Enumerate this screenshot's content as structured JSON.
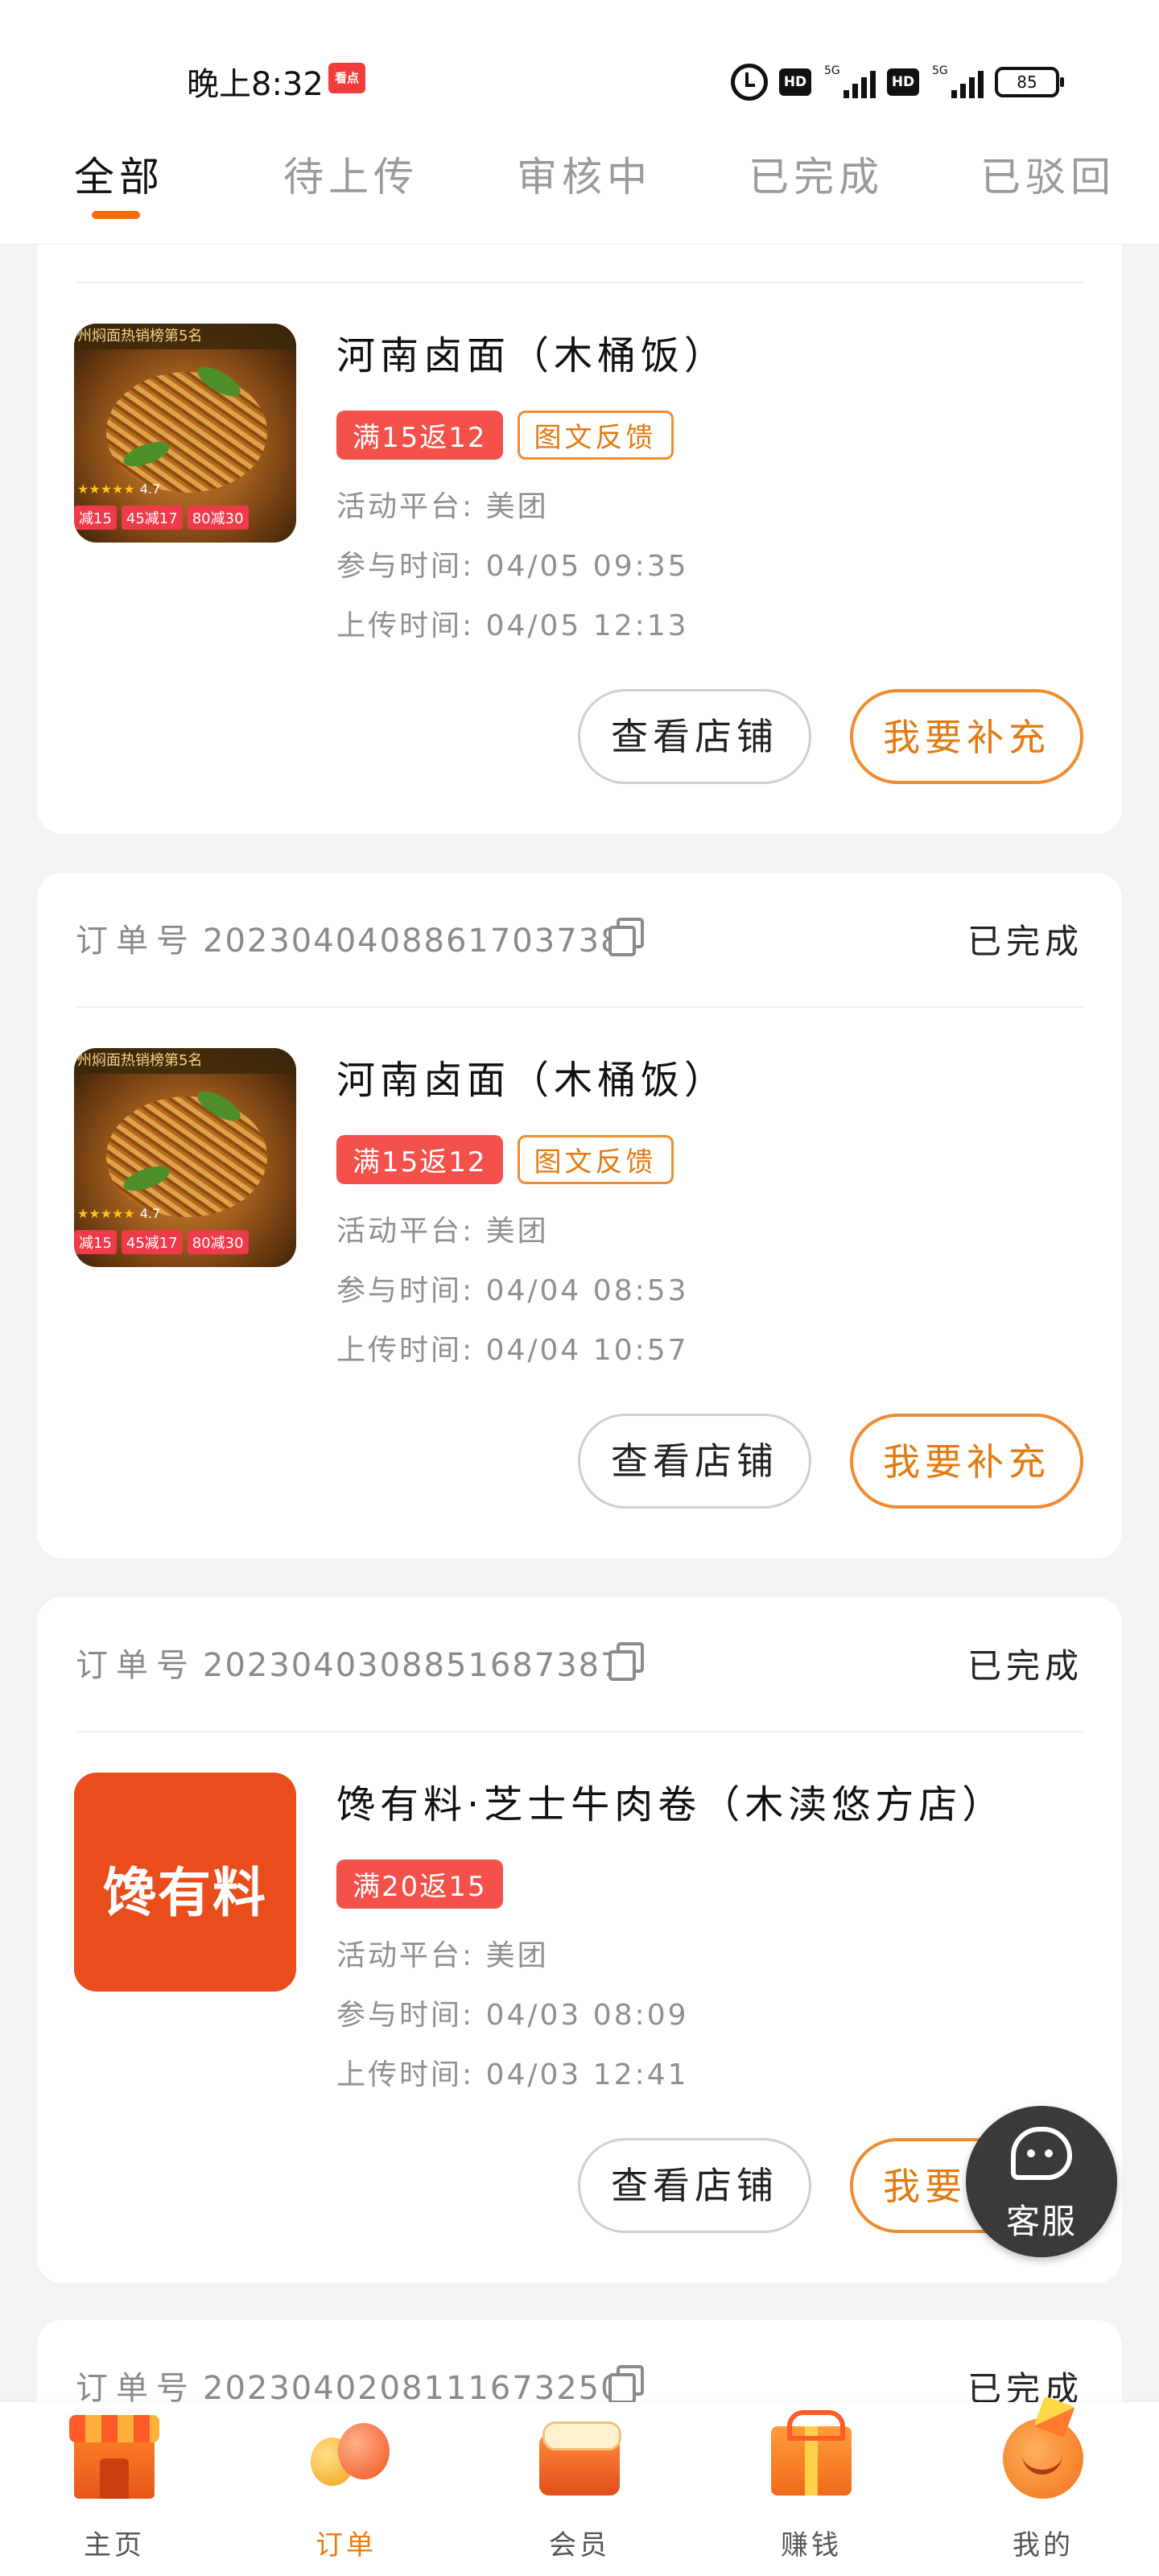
{
  "status_bar": {
    "time": "晚上8:32",
    "app_badge": "看点",
    "hd1": "HD",
    "hd2": "HD",
    "net1": "5G",
    "net2": "5G",
    "battery": "85"
  },
  "tabs": [
    {
      "label": "全部"
    },
    {
      "label": "待上传"
    },
    {
      "label": "审核中"
    },
    {
      "label": "已完成"
    },
    {
      "label": "已驳回"
    }
  ],
  "labels": {
    "order_no": "订单号",
    "platform": "活动平台:",
    "join_time": "参与时间:",
    "upload_time": "上传时间:",
    "view_store": "查看店铺",
    "supplement": "我要补充"
  },
  "orders": [
    {
      "shop_name": "河南卤面（木桶饭）",
      "tag_main": "满15返12",
      "tag_feedback": "图文反馈",
      "platform": "美团",
      "join_time": "04/05 09:35",
      "upload_time": "04/05 12:13",
      "thumb": {
        "rank": "州焖面热销榜第5名",
        "rating": "4.7",
        "promos": [
          "减15",
          "45减17",
          "80减30"
        ]
      }
    },
    {
      "order_no": "2023040408861703738",
      "status": "已完成",
      "shop_name": "河南卤面（木桶饭）",
      "tag_main": "满15返12",
      "tag_feedback": "图文反馈",
      "platform": "美团",
      "join_time": "04/04 08:53",
      "upload_time": "04/04 10:57",
      "thumb": {
        "rank": "州焖面热销榜第5名",
        "rating": "4.7",
        "promos": [
          "减15",
          "45减17",
          "80减30"
        ]
      }
    },
    {
      "order_no": "2023040308851687387",
      "status": "已完成",
      "shop_name": "馋有料·芝士牛肉卷（木渎悠方店）",
      "tag_main": "满20返15",
      "platform": "美团",
      "join_time": "04/03 08:09",
      "upload_time": "04/03 12:41",
      "thumb": {
        "brand": "馋有料"
      }
    },
    {
      "order_no": "2023040208111673250",
      "status": "已完成"
    }
  ],
  "floating": {
    "customer_service": "客服"
  },
  "bottom_nav": [
    {
      "label": "主页",
      "icon": "storefront-icon"
    },
    {
      "label": "订单",
      "icon": "balloons-icon",
      "active": true
    },
    {
      "label": "会员",
      "icon": "cake-icon"
    },
    {
      "label": "赚钱",
      "icon": "gift-icon"
    },
    {
      "label": "我的",
      "icon": "party-face-icon"
    }
  ],
  "colors": {
    "accent": "#ff6a00",
    "tag_red": "#f4514a",
    "outline_orange": "#f08c2e",
    "background": "#f4f3f1"
  }
}
